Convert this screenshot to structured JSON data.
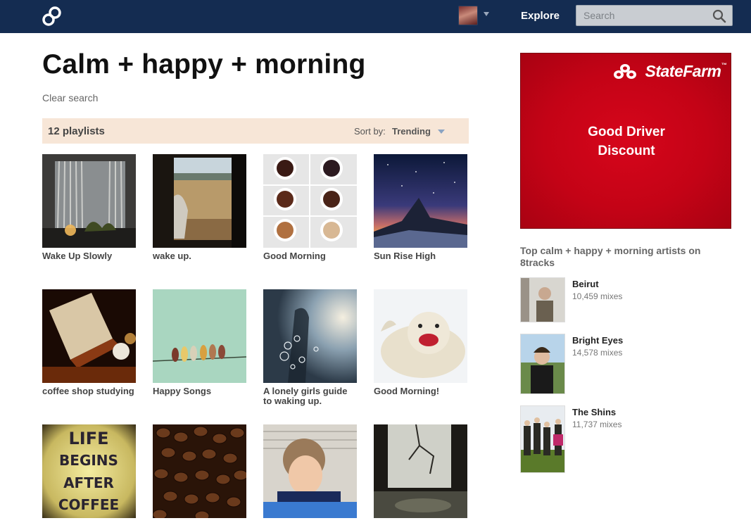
{
  "topbar": {
    "logo_icon": "8tracks-logo-icon",
    "nav_explore": "Explore",
    "search_placeholder": "Search",
    "search_icon": "search-icon",
    "background_color": "#142c51"
  },
  "search_results": {
    "title": "Calm + happy + morning",
    "clear_label": "Clear search",
    "count_label": "12 playlists",
    "sort_label": "Sort by:",
    "sort_value": "Trending",
    "bar_color": "#f7e6d7"
  },
  "playlists": [
    {
      "title": "Wake Up Slowly"
    },
    {
      "title": "wake up."
    },
    {
      "title": "Good Morning"
    },
    {
      "title": "Sun Rise High"
    },
    {
      "title": "coffee shop studying"
    },
    {
      "title": "Happy Songs"
    },
    {
      "title": "A lonely girls guide to waking up."
    },
    {
      "title": "Good Morning!"
    },
    {
      "title": ""
    },
    {
      "title": ""
    },
    {
      "title": ""
    },
    {
      "title": ""
    }
  ],
  "coffee_cover_text": [
    "LIFE",
    "BEGINS",
    "AFTER",
    "COFFEE"
  ],
  "ad": {
    "brand": "StateFarm",
    "trademark": "™",
    "line1": "Good Driver",
    "line2": "Discount",
    "color": "#c40316"
  },
  "artists": {
    "heading": "Top calm + happy + morning artists on 8tracks",
    "items": [
      {
        "name": "Beirut",
        "mixes": "10,459 mixes"
      },
      {
        "name": "Bright Eyes",
        "mixes": "14,578 mixes"
      },
      {
        "name": "The Shins",
        "mixes": "11,737 mixes"
      }
    ]
  }
}
